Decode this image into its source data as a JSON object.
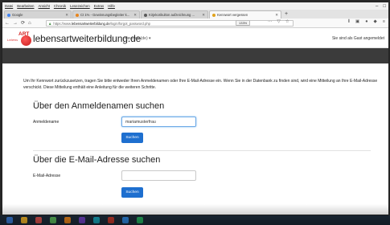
{
  "menubar": {
    "items": [
      "Datei",
      "Bearbeiten",
      "Ansicht",
      "Chronik",
      "Lesezeichen",
      "Extras",
      "Hilfe"
    ]
  },
  "tabs": [
    {
      "label": "Google",
      "color": "#4285f4"
    },
    {
      "label": "Ct 1% - Gewinnungsbegleiter k...",
      "color": "#e8851c"
    },
    {
      "label": "Kirjekorikulton aufzeichnung ...",
      "color": "#5a5a5a"
    },
    {
      "label": "Kennwort vergessen",
      "color": "#e0a21c"
    }
  ],
  "navbar": {
    "back": "←",
    "forward": "→",
    "reload": "⟳",
    "home": "⌂",
    "url_prefix": "https://www.",
    "url_domain": "lebensartweiterbildung.de",
    "url_path": "/login/forgot_password.php",
    "zoom": "133%"
  },
  "site": {
    "logo_small": "Lebens",
    "logo_art": "ART",
    "name": "lebensartweiterbildung.de",
    "language": "Deutsch (de) ▾",
    "login_status": "Sie sind als Gast angemeldet"
  },
  "form": {
    "intro": "Um Ihr Kennwort zurückzusetzen, tragen Sie bitte entweder Ihren Anmeldenamen oder Ihre E-Mail-Adresse ein. Wenn Sie in der Datenbank zu finden sind, wird eine Mitteilung an Ihre E-Mail-Adresse verschickt. Diese Mitteilung enthält eine Anleitung für die weiteren Schritte.",
    "section1_title": "Über den Anmeldenamen suchen",
    "username_label": "Anmeldename",
    "username_value": "mariamusterfrau",
    "search_button": "Suchen",
    "section2_title": "Über die E-Mail-Adresse suchen",
    "email_label": "E-Mail-Adresse",
    "email_value": "",
    "search_button2": "Suchen"
  },
  "colors": {
    "primary_button": "#1e6fcf",
    "focus_border": "#6aa8e6",
    "logo_red": "#d42020",
    "dark_strip": "#3b3b3b"
  }
}
